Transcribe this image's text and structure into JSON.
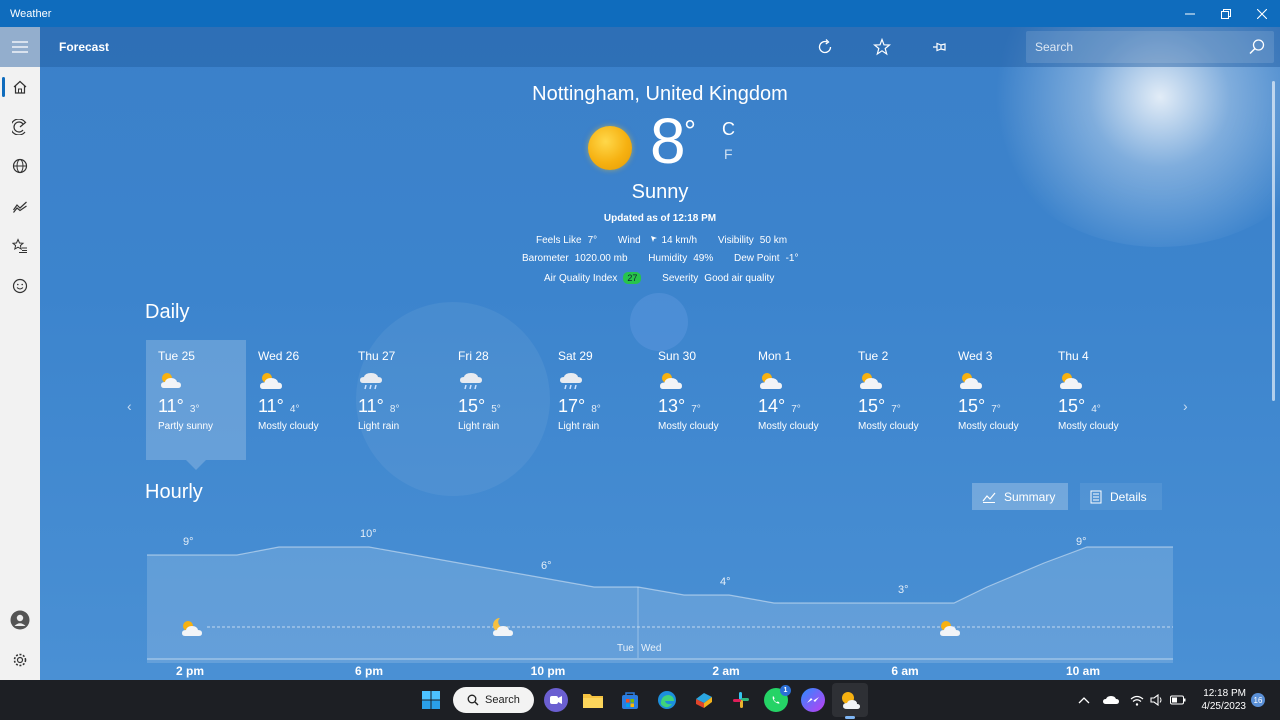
{
  "window": {
    "title": "Weather",
    "minimize_icon": "minimize-icon",
    "maximize_icon": "restore-icon",
    "close_icon": "close-icon"
  },
  "commandbar": {
    "title": "Forecast",
    "search_placeholder": "Search",
    "icons": [
      "refresh-icon",
      "favorite-star-icon",
      "pin-icon",
      "dark-mode-moon-icon",
      "search-icon"
    ]
  },
  "nav": {
    "items": [
      "home-icon",
      "radar-icon",
      "globe-icon",
      "historical-chart-icon",
      "favorites-icon",
      "life-icon"
    ],
    "bottom_items": [
      "account-icon",
      "settings-icon"
    ],
    "active": "home"
  },
  "current": {
    "location": "Nottingham, United Kingdom",
    "temperature": "8",
    "degree_symbol": "°",
    "unit_c": "C",
    "unit_f": "F",
    "condition": "Sunny",
    "updated": "Updated as of 12:18 PM",
    "feels_like_label": "Feels Like",
    "feels_like": "7°",
    "wind_label": "Wind",
    "wind": "14 km/h",
    "visibility_label": "Visibility",
    "visibility": "50 km",
    "barometer_label": "Barometer",
    "barometer": "1020.00 mb",
    "humidity_label": "Humidity",
    "humidity": "49%",
    "dew_point_label": "Dew Point",
    "dew_point": "-1°",
    "aqi_label": "Air Quality Index",
    "aqi": "27",
    "severity_label": "Severity",
    "severity": "Good air quality",
    "colors": {
      "aqi_good": "#27c44a",
      "accent": "#0f6cbd"
    }
  },
  "daily": {
    "title": "Daily",
    "days": [
      {
        "name": "Tue 25",
        "high": "11°",
        "low": "3°",
        "desc": "Partly sunny",
        "icon": "partly-sunny-icon"
      },
      {
        "name": "Wed 26",
        "high": "11°",
        "low": "4°",
        "desc": "Mostly cloudy",
        "icon": "mostly-cloudy-icon"
      },
      {
        "name": "Thu 27",
        "high": "11°",
        "low": "8°",
        "desc": "Light rain",
        "icon": "light-rain-icon"
      },
      {
        "name": "Fri 28",
        "high": "15°",
        "low": "5°",
        "desc": "Light rain",
        "icon": "light-rain-icon"
      },
      {
        "name": "Sat 29",
        "high": "17°",
        "low": "8°",
        "desc": "Light rain",
        "icon": "light-rain-icon"
      },
      {
        "name": "Sun 30",
        "high": "13°",
        "low": "7°",
        "desc": "Mostly cloudy",
        "icon": "mostly-cloudy-icon"
      },
      {
        "name": "Mon 1",
        "high": "14°",
        "low": "7°",
        "desc": "Mostly cloudy",
        "icon": "mostly-cloudy-icon"
      },
      {
        "name": "Tue 2",
        "high": "15°",
        "low": "7°",
        "desc": "Mostly cloudy",
        "icon": "mostly-cloudy-icon"
      },
      {
        "name": "Wed 3",
        "high": "15°",
        "low": "7°",
        "desc": "Mostly cloudy",
        "icon": "mostly-cloudy-icon"
      },
      {
        "name": "Thu 4",
        "high": "15°",
        "low": "4°",
        "desc": "Mostly cloudy",
        "icon": "mostly-cloudy-icon"
      }
    ]
  },
  "hourly": {
    "title": "Hourly",
    "summary_label": "Summary",
    "details_label": "Details",
    "time_labels": [
      "2 pm",
      "6 pm",
      "10 pm",
      "2 am",
      "6 am",
      "10 am"
    ],
    "day_divider_left": "Tue",
    "day_divider_right": "Wed",
    "temps": [
      "9°",
      "10°",
      "6°",
      "4°",
      "3°",
      "9°"
    ],
    "icons": [
      "partly-cloudy-icon",
      "partly-cloudy-night-icon",
      "partly-cloudy-icon"
    ]
  },
  "taskbar": {
    "search_label": "Search",
    "apps": [
      "windows-start-icon",
      "teams-chat-icon",
      "file-explorer-icon",
      "microsoft-store-icon",
      "edge-browser-icon",
      "sway-icon",
      "slack-icon",
      "whatsapp-icon",
      "messenger-icon",
      "weather-app-icon"
    ],
    "whatsapp_badge": "1",
    "tray_icons": [
      "chevron-up-icon",
      "onedrive-cloud-icon",
      "wifi-icon",
      "volume-icon",
      "battery-icon"
    ],
    "time": "12:18 PM",
    "date": "4/25/2023",
    "notification_count": "16"
  }
}
